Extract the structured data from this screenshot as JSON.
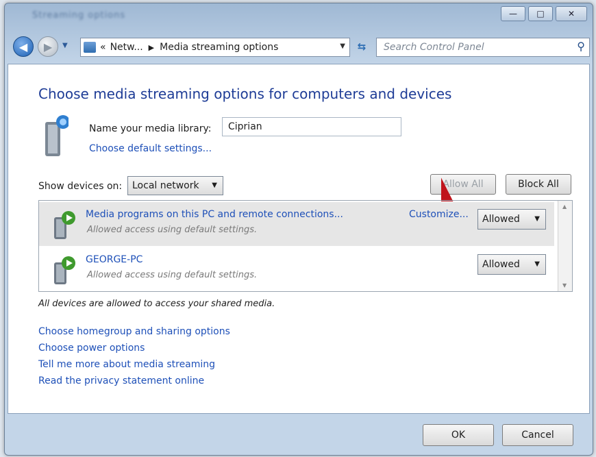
{
  "window": {
    "blurred_title": "Streaming options",
    "minimize_glyph": "—",
    "maximize_glyph": "□",
    "close_glyph": "✕"
  },
  "nav": {
    "breadcrumb_prefix": "«",
    "breadcrumb_parent": "Netw...",
    "breadcrumb_separator": "▶",
    "breadcrumb_current": "Media streaming options",
    "search_placeholder": "Search Control Panel"
  },
  "main": {
    "heading": "Choose media streaming options for computers and devices",
    "library_label": "Name your media library:",
    "library_value": "Ciprian",
    "default_settings_link": "Choose default settings...",
    "show_devices_label": "Show devices on:",
    "network_option": "Local network",
    "allow_all_label": "Allow All",
    "block_all_label": "Block All",
    "devices": [
      {
        "name": "Media programs on this PC and remote connections...",
        "description": "Allowed access using default settings.",
        "customize": "Customize...",
        "status": "Allowed"
      },
      {
        "name": "GEORGE-PC",
        "description": "Allowed access using default settings.",
        "status": "Allowed"
      }
    ],
    "status_text": "All devices are allowed to access your shared media.",
    "links": [
      "Choose homegroup and sharing options",
      "Choose power options",
      "Tell me more about media streaming",
      "Read the privacy statement online"
    ]
  },
  "footer": {
    "ok_label": "OK",
    "cancel_label": "Cancel"
  },
  "colors": {
    "link": "#1e50b8",
    "heading": "#1e3c96",
    "annotation_arrow": "#c0141c"
  }
}
